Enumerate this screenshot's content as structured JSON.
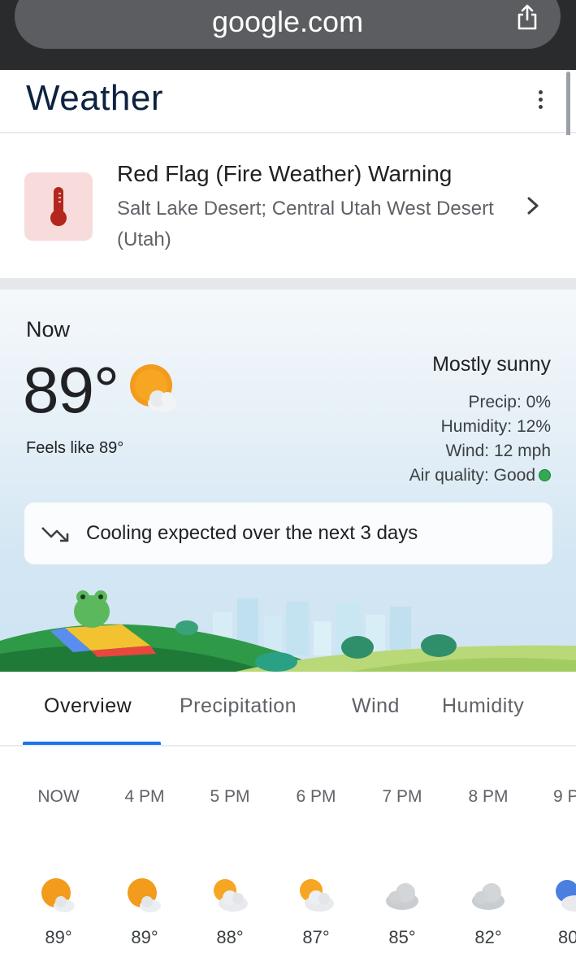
{
  "browser": {
    "url": "google.com",
    "share_icon": "share-icon"
  },
  "header": {
    "title": "Weather",
    "menu_icon": "more-vert-icon"
  },
  "alert": {
    "icon": "thermometer-icon",
    "title": "Red Flag (Fire Weather) Warning",
    "subtitle": "Salt Lake Desert; Central Utah West Desert (Utah)",
    "accent_color": "#c5221f"
  },
  "current": {
    "label": "Now",
    "temperature": "89°",
    "icon": "mostly-sunny-icon",
    "feels_like": "Feels like 89°",
    "condition": "Mostly sunny",
    "precip": "Precip: 0%",
    "humidity": "Humidity: 12%",
    "wind": "Wind: 12 mph",
    "air_quality": "Air quality: Good",
    "air_quality_color": "#34a853"
  },
  "trend": {
    "icon": "trending-down-icon",
    "text": "Cooling expected over the next 3 days"
  },
  "tabs": [
    {
      "label": "Overview",
      "active": true
    },
    {
      "label": "Precipitation",
      "active": false
    },
    {
      "label": "Wind",
      "active": false
    },
    {
      "label": "Humidity",
      "active": false
    }
  ],
  "hourly": [
    {
      "time": "NOW",
      "icon": "mostly-sunny-icon",
      "temp": "89°"
    },
    {
      "time": "4 PM",
      "icon": "mostly-sunny-icon",
      "temp": "89°"
    },
    {
      "time": "5 PM",
      "icon": "partly-cloudy-icon",
      "temp": "88°"
    },
    {
      "time": "6 PM",
      "icon": "partly-cloudy-icon",
      "temp": "87°"
    },
    {
      "time": "7 PM",
      "icon": "cloudy-icon",
      "temp": "85°"
    },
    {
      "time": "8 PM",
      "icon": "cloudy-icon",
      "temp": "82°"
    },
    {
      "time": "9 P",
      "icon": "partly-cloudy-night-icon",
      "temp": "80"
    }
  ]
}
